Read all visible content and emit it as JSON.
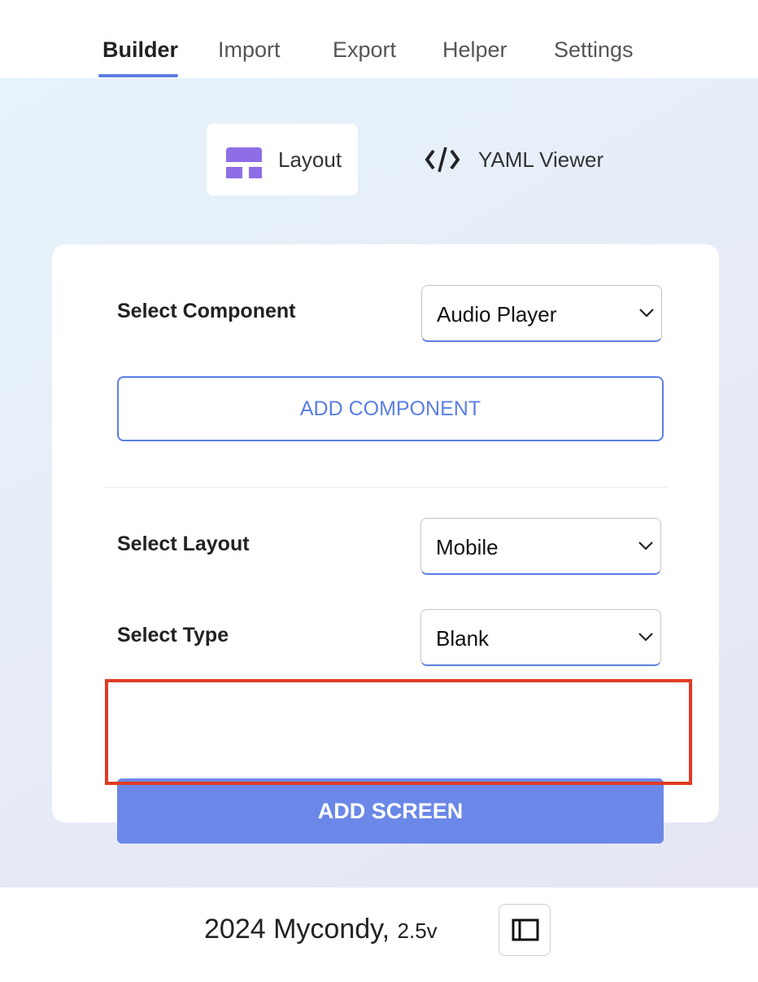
{
  "nav": {
    "tabs": [
      {
        "label": "Builder",
        "active": true
      },
      {
        "label": "Import",
        "active": false
      },
      {
        "label": "Export",
        "active": false
      },
      {
        "label": "Helper",
        "active": false
      },
      {
        "label": "Settings",
        "active": false
      }
    ]
  },
  "sub_tabs": {
    "layout": {
      "label": "Layout",
      "icon": "layout-icon",
      "active": true
    },
    "yaml": {
      "label": "YAML Viewer",
      "icon": "code-icon",
      "active": false
    }
  },
  "form": {
    "component": {
      "label": "Select Component",
      "value": "Audio Player"
    },
    "add_component_label": "ADD COMPONENT",
    "layout": {
      "label": "Select Layout",
      "value": "Mobile"
    },
    "type": {
      "label": "Select Type",
      "value": "Blank"
    },
    "add_screen_label": "ADD SCREEN"
  },
  "footer": {
    "text": "2024 Mycondy,",
    "version": "2.5v",
    "toggle_icon": "sidebar-toggle-icon"
  },
  "colors": {
    "accent": "#5b7ee5",
    "primary_button": "#6b88e8",
    "layout_icon": "#8e6ee6",
    "highlight": "#e03b24"
  }
}
